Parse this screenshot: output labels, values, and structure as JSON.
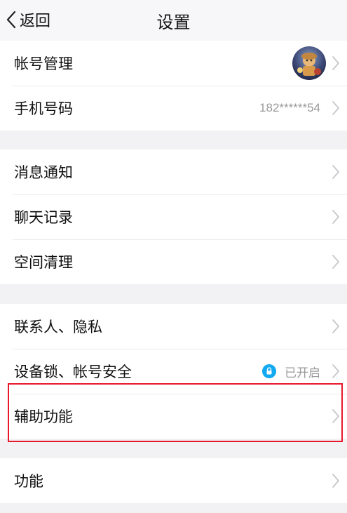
{
  "header": {
    "back_label": "返回",
    "title": "设置"
  },
  "groups": [
    {
      "items": [
        {
          "label": "帐号管理"
        },
        {
          "label": "手机号码",
          "value": "182******54"
        }
      ]
    },
    {
      "items": [
        {
          "label": "消息通知"
        },
        {
          "label": "聊天记录"
        },
        {
          "label": "空间清理"
        }
      ]
    },
    {
      "items": [
        {
          "label": "联系人、隐私"
        },
        {
          "label": "设备锁、帐号安全",
          "status": "已开启"
        },
        {
          "label": "辅助功能"
        }
      ]
    },
    {
      "items": [
        {
          "label": "功能"
        }
      ]
    }
  ],
  "colors": {
    "background": "#f2f2f5",
    "accent": "#12a9f0",
    "highlight": "#e8182c"
  },
  "icons": {
    "back": "chevron-left-icon",
    "row": "chevron-right-icon",
    "lock": "lock-icon"
  }
}
